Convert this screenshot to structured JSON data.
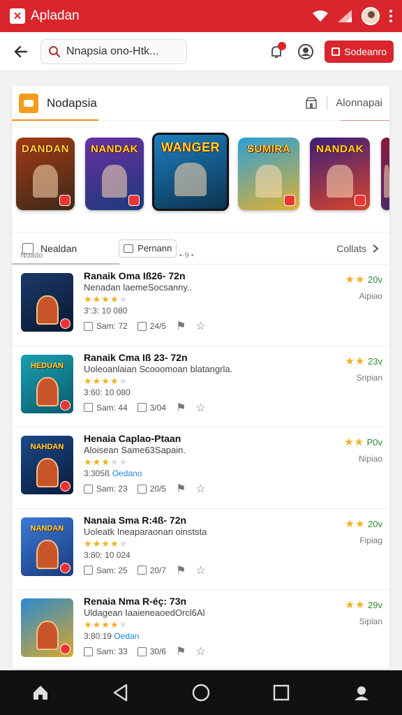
{
  "status": {
    "app_title": "Apladan",
    "brand_color": "#d8262c"
  },
  "appbar": {
    "search_value": "Nnapsia ono-Htk...",
    "cta_label": "Sodeanro"
  },
  "card": {
    "title": "Nodapsia",
    "right_link": "Alonnapai",
    "accent_color": "#f28a1a"
  },
  "carousel": {
    "tiles": [
      {
        "title": "DANDAN",
        "colors": [
          "#a43a14",
          "#3b2a1a"
        ]
      },
      {
        "title": "NANDAK",
        "colors": [
          "#6b2fa3",
          "#1c3a7a"
        ]
      },
      {
        "title": "WANGER",
        "colors": [
          "#1c7fbf",
          "#0d3350"
        ]
      },
      {
        "title": "SUMIRA",
        "colors": [
          "#2ba0d8",
          "#e0b030"
        ]
      },
      {
        "title": "NANDAK",
        "colors": [
          "#3a1f7a",
          "#d8462a"
        ]
      },
      {
        "title": "",
        "colors": [
          "#8a1a3a",
          "#4a2a6a"
        ]
      }
    ],
    "caption_left": "Noado",
    "caption_mid": "•·9 •"
  },
  "filters": {
    "left_label": "Nealdan",
    "pill_label": "Pernann",
    "right_label": "Collats"
  },
  "rows": [
    {
      "title": "Ranaik Oma Iß26- 72n",
      "subtitle": "Nenadan laemeSocsanny..",
      "stars": "★★★★",
      "stars_off": "★",
      "meta": "3′:3: 10 080",
      "meta_accent": "",
      "saves": "Sam: 72",
      "count": "24/5",
      "rating": "20v",
      "platform": "Aipiao",
      "thumb_colors": [
        "#1a3a6a",
        "#0a1830"
      ],
      "thumb_title": ""
    },
    {
      "title": "Ranaik Cma Iß 23- 72n",
      "subtitle": "Uoleoanlaian Scooomoan blatangrla.",
      "stars": "★★★★",
      "stars_off": "★",
      "meta": "3:60: 10 080",
      "meta_accent": "",
      "saves": "Sam: 44",
      "count": "3/04",
      "rating": "23v",
      "platform": "Sripian",
      "thumb_colors": [
        "#1aa0b0",
        "#0a5a6a"
      ],
      "thumb_title": "HEDUAN"
    },
    {
      "title": "Henaia Caplao-Ptaan",
      "subtitle": "Aloisean Same63Sapain.",
      "stars": "★★★",
      "stars_off": "★★",
      "meta": "3:305ß",
      "meta_accent": "Oedano",
      "saves": "Sam: 23",
      "count": "20/5",
      "rating": "P0v",
      "platform": "Nipiao",
      "thumb_colors": [
        "#1a4a8a",
        "#0a1a3a"
      ],
      "thumb_title": "NAHDAN"
    },
    {
      "title": "Nanaia Sma R:4ß- 72n",
      "subtitle": "Uoleatk Ineaparaonan oinststa",
      "stars": "★★★★",
      "stars_off": "★",
      "meta": "3:80: 10 024",
      "meta_accent": "",
      "saves": "Sam: 25",
      "count": "20/7",
      "rating": "20v",
      "platform": "Fipiag",
      "thumb_colors": [
        "#3a7ad8",
        "#1a3a7a"
      ],
      "thumb_title": "NANDAN"
    },
    {
      "title": "Renaia Nma R-éç: 73n",
      "subtitle": "Uldagean IaaieneaoedOrcl6Al",
      "stars": "★★★★",
      "stars_off": "★",
      "meta": "3:80:19",
      "meta_accent": "Oedan",
      "saves": "Sam: 33",
      "count": "30/6",
      "rating": "29v",
      "platform": "Sipian",
      "thumb_colors": [
        "#2a8ad0",
        "#d8a82a"
      ],
      "thumb_title": ""
    }
  ]
}
